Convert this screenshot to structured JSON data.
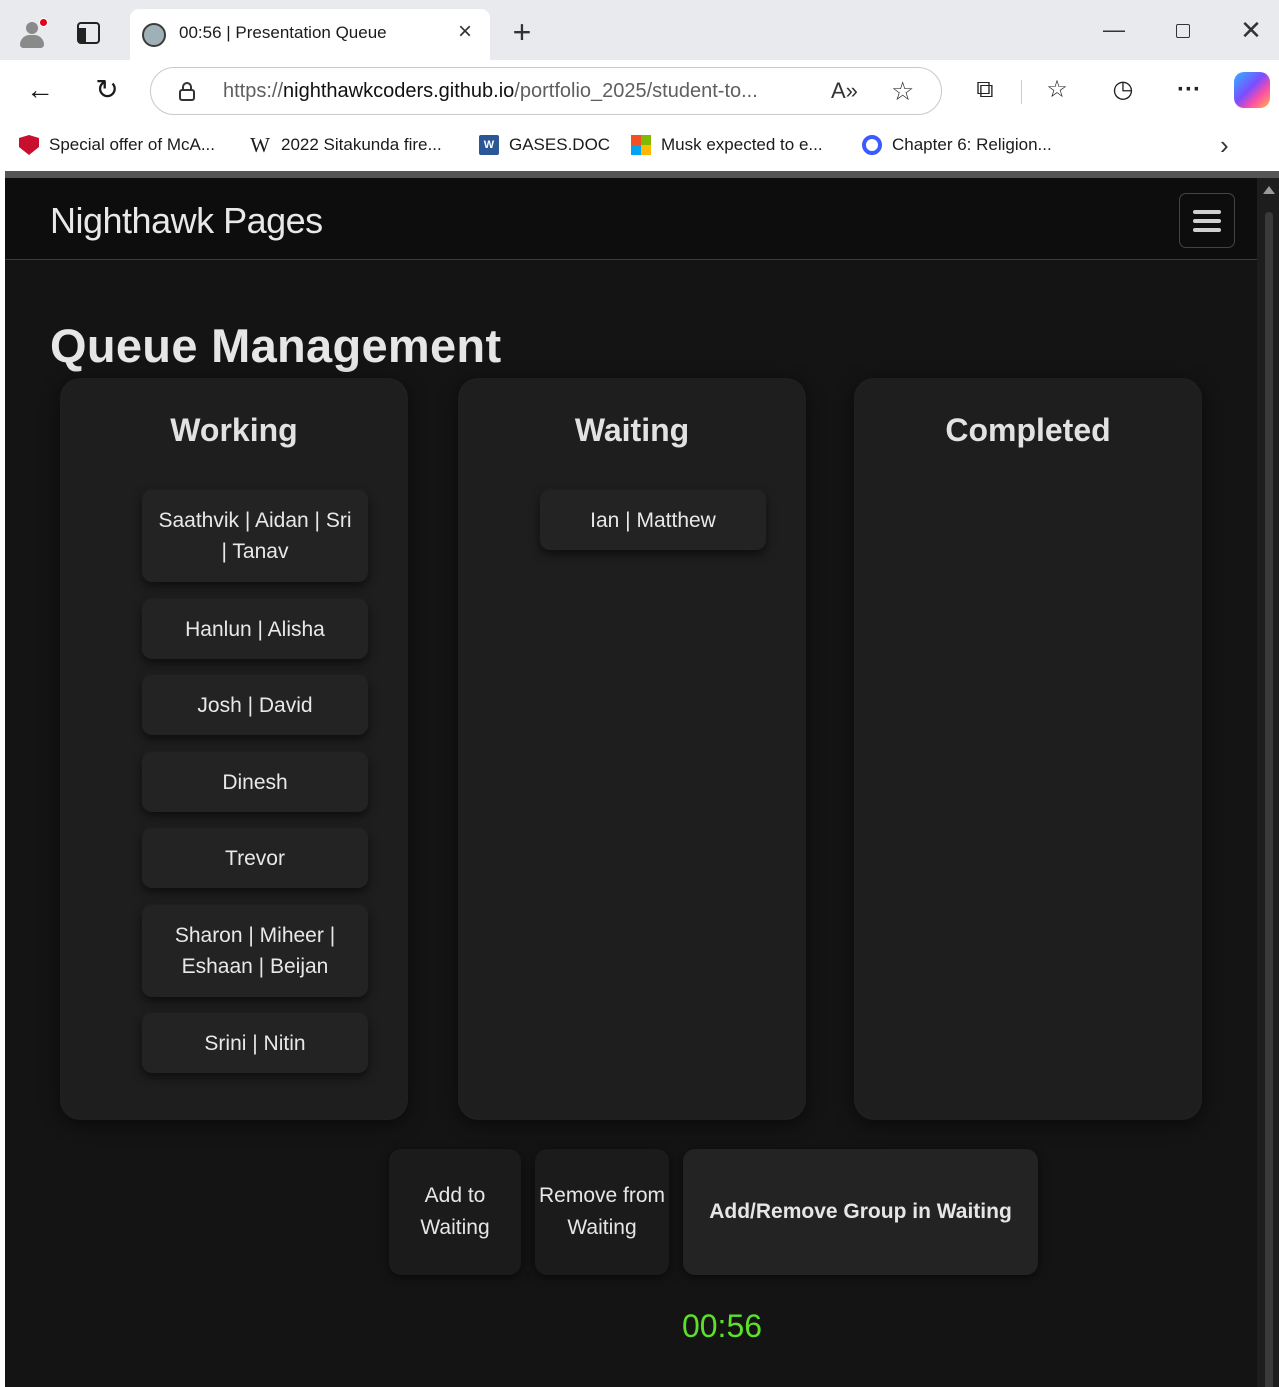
{
  "browser": {
    "tab_title": "00:56 | Presentation Queue",
    "url_prefix": "https://",
    "url_host": "nighthawkcoders.github.io",
    "url_path": "/portfolio_2025/student-to...",
    "bookmarks": [
      {
        "label": "Special offer of McA...",
        "icon": "mcafee-icon"
      },
      {
        "label": "2022 Sitakunda fire...",
        "icon": "wikipedia-icon"
      },
      {
        "label": "GASES.DOC",
        "icon": "word-doc-icon"
      },
      {
        "label": "Musk expected to e...",
        "icon": "microsoft-icon"
      },
      {
        "label": "Chapter 6: Religion...",
        "icon": "quizlet-icon"
      }
    ]
  },
  "site": {
    "brand": "Nighthawk Pages"
  },
  "page": {
    "title": "Queue Management",
    "columns": {
      "working": {
        "title": "Working",
        "groups": [
          "Saathvik | Aidan | Sri | Tanav",
          "Hanlun | Alisha",
          "Josh | David",
          "Dinesh",
          "Trevor",
          "Sharon | Miheer | Eshaan | Beijan",
          "Srini | Nitin"
        ]
      },
      "waiting": {
        "title": "Waiting",
        "groups": [
          "Ian | Matthew"
        ]
      },
      "completed": {
        "title": "Completed",
        "groups": []
      }
    },
    "buttons": {
      "add": "Add to Waiting",
      "remove": "Remove from Waiting",
      "toggle_group": "Add/Remove Group in Waiting"
    },
    "timer": "00:56",
    "timer_color": "#5de02a"
  }
}
